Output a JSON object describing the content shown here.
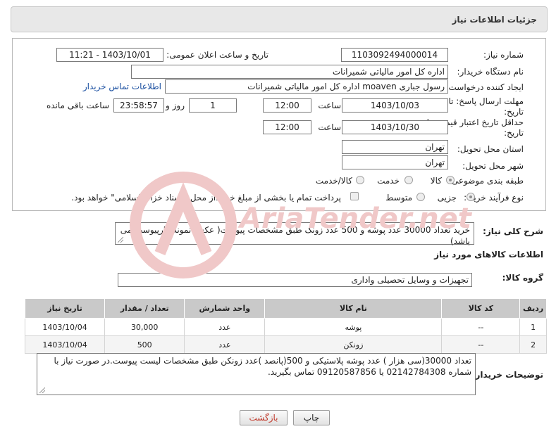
{
  "header": {
    "title": "جزئیات اطلاعات نیاز"
  },
  "form": {
    "need_number_label": "شماره نیاز:",
    "need_number": "1103092494000014",
    "announce_label": "تاریخ و ساعت اعلان عمومی:",
    "announce_value": "1403/10/01 - 11:21",
    "buyer_org_label": "نام دستگاه خریدار:",
    "buyer_org": "اداره کل امور مالیاتی شمیرانات",
    "creator_label": "ایجاد کننده درخواست:",
    "creator": "رسول جباری moaven اداره کل امور مالیاتی شمیرانات",
    "contact_link": "اطلاعات تماس خریدار",
    "deadline_label_1": "مهلت ارسال پاسخ: تا",
    "deadline_label_2": "تاریخ:",
    "deadline_date": "1403/10/03",
    "time_label": "ساعت",
    "deadline_time": "12:00",
    "days_value": "1",
    "days_label": "روز و",
    "remaining_value": "23:58:57",
    "remaining_label": "ساعت باقی مانده",
    "validity_label_1": "حداقل تاریخ اعتبار قیمت: تا",
    "validity_label_2": "تاریخ:",
    "validity_date": "1403/10/30",
    "validity_time": "12:00",
    "province_label": "استان محل تحویل:",
    "province": "تهران",
    "city_label": "شهر محل تحویل:",
    "city": "تهران",
    "category_label": "طبقه بندی موضوعی:",
    "category_options": [
      "کالا",
      "خدمت",
      "کالا/خدمت"
    ],
    "process_label": "نوع فرآیند خرید :",
    "process_options": [
      "جزیی",
      "متوسط"
    ],
    "payment_text": "پرداخت تمام یا بخشی از مبلغ خرید،از محل \"اسناد خزانه اسلامی\" خواهد بود."
  },
  "summary": {
    "label": "شرح کلی نیاز:",
    "text": "خرید تعداد 30000 عدد پوشه و 500 عدد زونک طبق مشخصات پیوست( عکس نمونه کارپیوست می باشد)"
  },
  "goods": {
    "section_title": "اطلاعات کالاهای مورد نیاز",
    "group_label": "گروه کالا:",
    "group_value": "تجهیزات و وسایل تحصیلی واداری",
    "columns": [
      "ردیف",
      "کد کالا",
      "نام کالا",
      "واحد شمارش",
      "تعداد / مقدار",
      "تاریخ نیاز"
    ],
    "rows": [
      [
        "1",
        "--",
        "پوشه",
        "عدد",
        "30,000",
        "1403/10/04"
      ],
      [
        "2",
        "--",
        "زونکن",
        "عدد",
        "500",
        "1403/10/04"
      ]
    ]
  },
  "notes": {
    "label": "توضیحات خریدار:",
    "text": "تعداد 30000(سی هزار ) عدد پوشه پلاستیکی و 500(پانصد )عدد زونکن طبق مشخصات لیست پیوست.در صورت نیاز با شماره 02142784308 یا 09120587856 تماس بگیرید."
  },
  "buttons": {
    "print": "چاپ",
    "back": "بازگشت"
  },
  "watermark": {
    "text": "AriaTender.net"
  },
  "colors": {
    "link": "#1a4fa0",
    "back_text": "#c0392b",
    "watermark": "#f0c8c8"
  }
}
